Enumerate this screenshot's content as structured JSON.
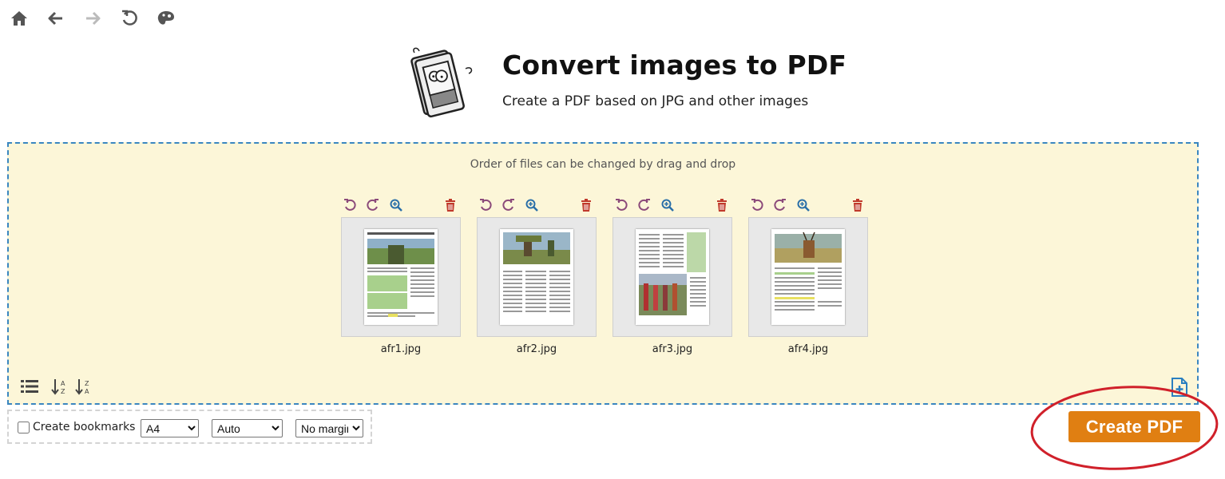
{
  "nav": {
    "home_icon": "home-icon",
    "back_icon": "arrow-left-icon",
    "forward_icon": "arrow-right-icon",
    "reload_icon": "reload-icon",
    "theme_icon": "palette-icon"
  },
  "header": {
    "title": "Convert images to PDF",
    "subtitle": "Create a PDF based on JPG and other images"
  },
  "droparea": {
    "hint": "Order of files can be changed by drag and drop",
    "files": [
      {
        "name": "afr1.jpg"
      },
      {
        "name": "afr2.jpg"
      },
      {
        "name": "afr3.jpg"
      },
      {
        "name": "afr4.jpg"
      }
    ]
  },
  "options": {
    "bookmarks_label": "Create bookmarks",
    "bookmarks_checked": false,
    "page_size": "A4",
    "orientation": "Auto",
    "margin": "No margin"
  },
  "actions": {
    "create_label": "Create PDF"
  },
  "colors": {
    "accent": "#e07f12",
    "drop_bg": "#fcf6d8",
    "drop_border": "#3a86c0",
    "rotate_icon": "#8b4a7a",
    "delete_icon": "#c0392b",
    "annotation": "#d0202a"
  }
}
